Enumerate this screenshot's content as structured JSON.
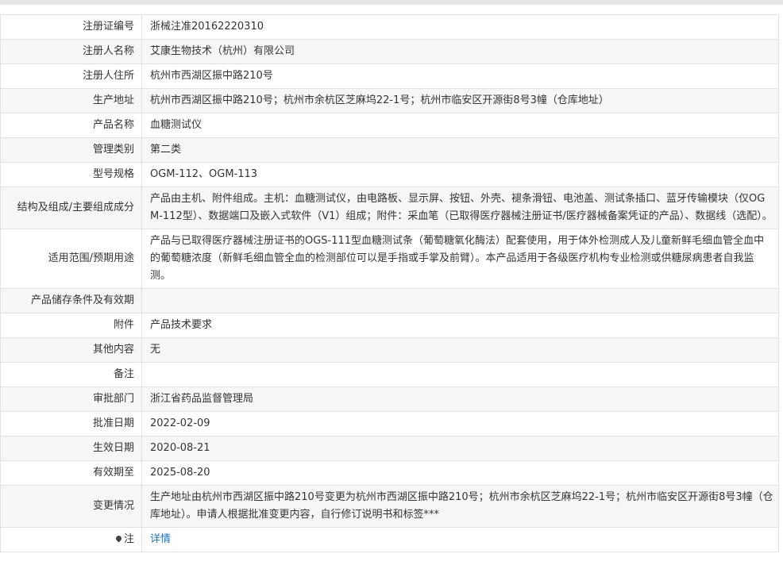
{
  "rows": [
    {
      "label": "注册证编号",
      "value": "浙械注准20162220310"
    },
    {
      "label": "注册人名称",
      "value": "艾康生物技术（杭州）有限公司"
    },
    {
      "label": "注册人住所",
      "value": "杭州市西湖区振中路210号"
    },
    {
      "label": "生产地址",
      "value": "杭州市西湖区振中路210号；杭州市余杭区芝麻坞22-1号；杭州市临安区开源街8号3幢（仓库地址）"
    },
    {
      "label": "产品名称",
      "value": "血糖测试仪"
    },
    {
      "label": "管理类别",
      "value": "第二类"
    },
    {
      "label": "型号规格",
      "value": "OGM-112、OGM-113"
    },
    {
      "label": "结构及组成/主要组成成分",
      "value": "产品由主机、附件组成。主机：血糖测试仪，由电路板、显示屏、按钮、外壳、褪条滑钮、电池盖、测试条插口、蓝牙传输模块（仅OGM-112型）、数据端口及嵌入式软件（V1）组成；附件：采血笔（已取得医疗器械注册证书/医疗器械备案凭证的产品）、数据线（选配）。"
    },
    {
      "label": "适用范围/预期用途",
      "value": "产品与已取得医疗器械注册证书的OGS-111型血糖测试条（葡萄糖氧化酶法）配套使用，用于体外检测成人及儿童新鲜毛细血管全血中的葡萄糖浓度（新鲜毛细血管全血的检测部位可以是手指或手掌及前臂）。本产品适用于各级医疗机构专业检测或供糖尿病患者自我监测。"
    },
    {
      "label": "产品储存条件及有效期",
      "value": ""
    },
    {
      "label": "附件",
      "value": "产品技术要求"
    },
    {
      "label": "其他内容",
      "value": "无"
    },
    {
      "label": "备注",
      "value": ""
    },
    {
      "label": "审批部门",
      "value": "浙江省药品监督管理局"
    },
    {
      "label": "批准日期",
      "value": "2022-02-09"
    },
    {
      "label": "生效日期",
      "value": "2020-08-21"
    },
    {
      "label": "有效期至",
      "value": "2025-08-20"
    },
    {
      "label": "变更情况",
      "value": "生产地址由杭州市西湖区振中路210号变更为杭州市西湖区振中路210号；杭州市余杭区芝麻坞22-1号；杭州市临安区开源街8号3幢（仓库地址）。申请人根据批准变更内容，自行修订说明书和标签***"
    }
  ],
  "note": {
    "label": "注",
    "icon": "pin-icon",
    "link_text": "详情"
  },
  "colors": {
    "border": "#e2e2e2",
    "row_alt": "#f6f6f6",
    "link": "#1a73c8"
  }
}
